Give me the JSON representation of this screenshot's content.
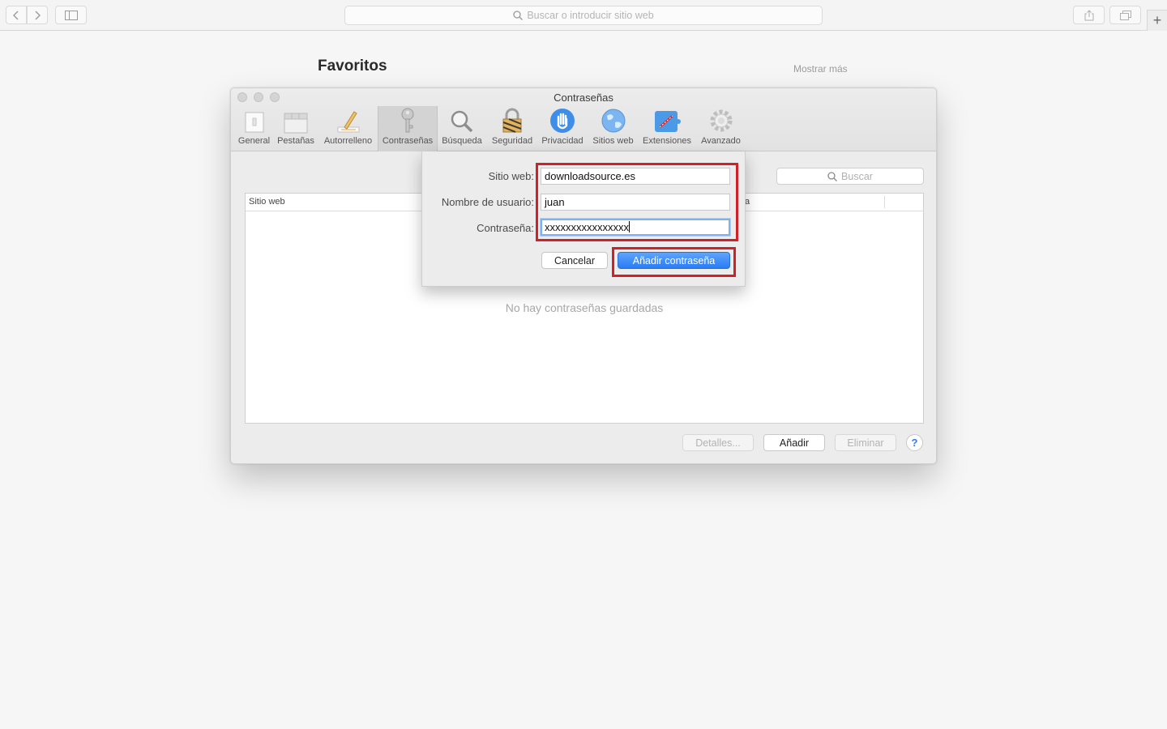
{
  "browser": {
    "address_placeholder": "Buscar o introducir sitio web",
    "new_tab_label": "+"
  },
  "favorites": {
    "title": "Favoritos",
    "show_more": "Mostrar más"
  },
  "prefs": {
    "title": "Contraseñas",
    "tabs": [
      {
        "label": "General",
        "icon": "general-icon"
      },
      {
        "label": "Pestañas",
        "icon": "tabs-icon"
      },
      {
        "label": "Autorrelleno",
        "icon": "autofill-icon"
      },
      {
        "label": "Contraseñas",
        "icon": "key-icon",
        "active": true
      },
      {
        "label": "Búsqueda",
        "icon": "search-icon"
      },
      {
        "label": "Seguridad",
        "icon": "lock-icon"
      },
      {
        "label": "Privacidad",
        "icon": "hand-icon"
      },
      {
        "label": "Sitios web",
        "icon": "globe-icon"
      },
      {
        "label": "Extensiones",
        "icon": "puzzle-icon"
      },
      {
        "label": "Avanzado",
        "icon": "gear-icon"
      }
    ],
    "search_placeholder": "Buscar",
    "table": {
      "column_site": "Sitio web",
      "column_partial": "a",
      "empty_message": "No hay contraseñas guardadas"
    },
    "buttons": {
      "details": "Detalles...",
      "add": "Añadir",
      "remove": "Eliminar",
      "help": "?"
    }
  },
  "add_sheet": {
    "site_label": "Sitio web:",
    "site_value": "downloadsource.es",
    "user_label": "Nombre de usuario:",
    "user_value": "juan",
    "password_label": "Contraseña:",
    "password_value": "xxxxxxxxxxxxxxxx",
    "cancel_label": "Cancelar",
    "confirm_label": "Añadir contraseña"
  },
  "colors": {
    "accent": "#2a7cf5",
    "highlight": "#d0202a"
  }
}
